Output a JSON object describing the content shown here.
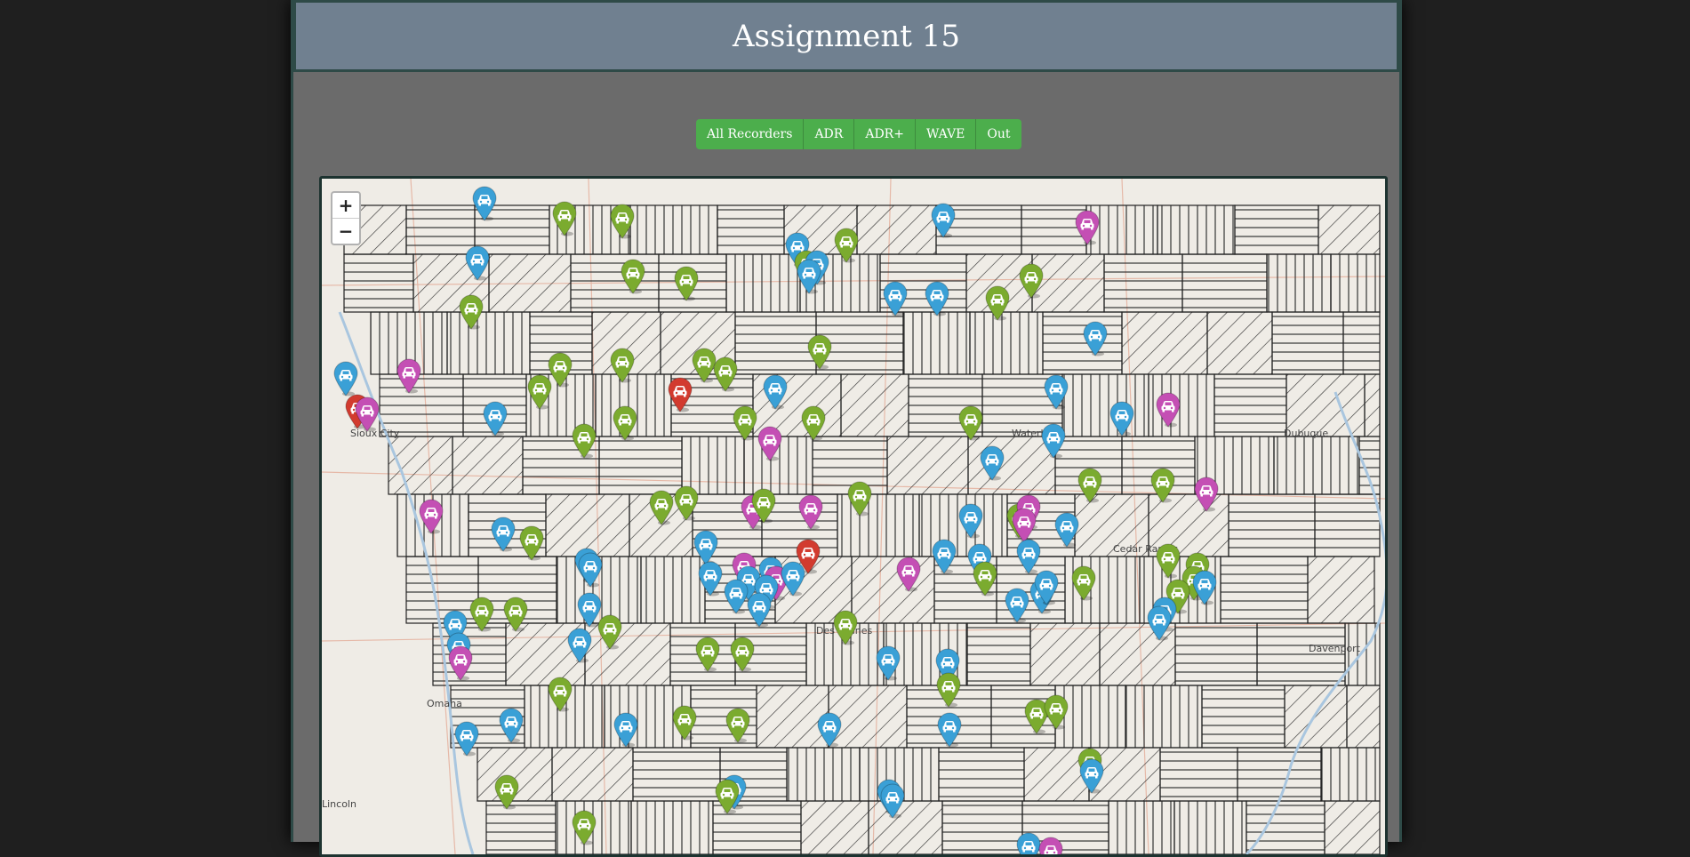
{
  "title": "Assignment 15",
  "buttons": [
    "All Recorders",
    "ADR",
    "ADR+",
    "WAVE",
    "Out"
  ],
  "zoom": {
    "in": "+",
    "out": "−"
  },
  "cities": [
    "Sioux City",
    "Waterloo",
    "Dubuque",
    "Cedar Rapids",
    "Des Moines",
    "Omaha",
    "Davenport",
    "Lincoln"
  ],
  "colors": {
    "green": "#7bab2f",
    "blue": "#3aa0d6",
    "magenta": "#c44fb4",
    "red": "#d23b2f"
  },
  "marker_icon": "car-icon"
}
